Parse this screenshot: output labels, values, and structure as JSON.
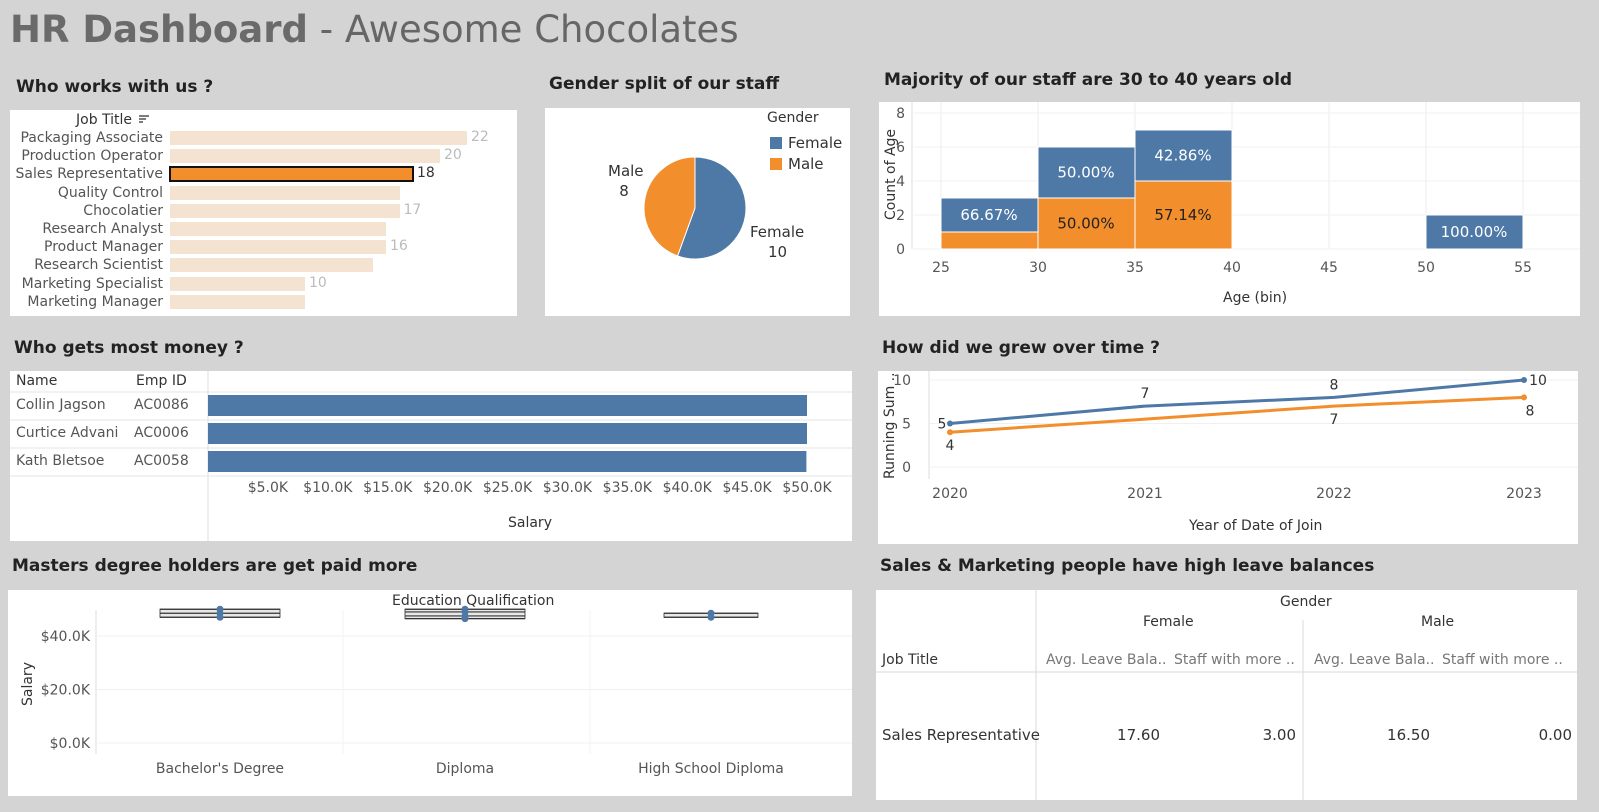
{
  "header": {
    "title_bold": "HR Dashboard",
    "title_rest": " - Awesome Chocolates"
  },
  "who_works": {
    "title": "Who works with us ?",
    "column_header": "Job Title",
    "rows": [
      {
        "label": "Packaging Associate",
        "value": 22,
        "show_value": true,
        "selected": false
      },
      {
        "label": "Production Operator",
        "value": 20,
        "show_value": true,
        "selected": false
      },
      {
        "label": "Sales Representative",
        "value": 18,
        "show_value": true,
        "selected": true
      },
      {
        "label": "Quality Control",
        "value": 17,
        "show_value": false,
        "selected": false
      },
      {
        "label": "Chocolatier",
        "value": 17,
        "show_value": true,
        "selected": false
      },
      {
        "label": "Research Analyst",
        "value": 16,
        "show_value": false,
        "selected": false
      },
      {
        "label": "Product Manager",
        "value": 16,
        "show_value": true,
        "selected": false
      },
      {
        "label": "Research Scientist",
        "value": 15,
        "show_value": false,
        "selected": false
      },
      {
        "label": "Marketing Specialist",
        "value": 10,
        "show_value": true,
        "selected": false
      },
      {
        "label": "Marketing Manager",
        "value": 10,
        "show_value": false,
        "selected": false
      }
    ],
    "colors": {
      "bar": "#f5e3d1",
      "selected": "#f28e2b"
    }
  },
  "gender_split": {
    "title": "Gender split of our staff",
    "legend_title": "Gender",
    "legend": [
      {
        "label": "Female",
        "color": "#4e79a7"
      },
      {
        "label": "Male",
        "color": "#f28e2b"
      }
    ],
    "male_label": "Male",
    "male_value": "8",
    "female_label": "Female",
    "female_value": "10",
    "chart_data": {
      "type": "pie",
      "slices": [
        {
          "label": "Female",
          "value": 10
        },
        {
          "label": "Male",
          "value": 8
        }
      ]
    }
  },
  "age_chart": {
    "title": "Majority of our staff are 30 to 40 years old",
    "ylabel": "Count of Age",
    "xlabel": "Age (bin)",
    "y_ticks": [
      "0",
      "2",
      "4",
      "6",
      "8"
    ],
    "x_ticks": [
      "25",
      "30",
      "35",
      "40",
      "45",
      "50",
      "55"
    ],
    "chart_data": {
      "type": "bar",
      "stacked": true,
      "bins": [
        25,
        30,
        35,
        50
      ],
      "ylim": [
        0,
        8
      ],
      "series": [
        {
          "name": "Male",
          "values": [
            1,
            3,
            4,
            0
          ]
        },
        {
          "name": "Female",
          "values": [
            2,
            3,
            3,
            2
          ]
        }
      ],
      "labels": [
        {
          "bin": 25,
          "series": "Female",
          "text": "66.67%"
        },
        {
          "bin": 30,
          "series": "Female",
          "text": "50.00%"
        },
        {
          "bin": 30,
          "series": "Male",
          "text": "50.00%"
        },
        {
          "bin": 35,
          "series": "Female",
          "text": "42.86%"
        },
        {
          "bin": 35,
          "series": "Male",
          "text": "57.14%"
        },
        {
          "bin": 50,
          "series": "Female",
          "text": "100.00%"
        }
      ]
    }
  },
  "money": {
    "title": "Who gets most money ?",
    "col_name": "Name",
    "col_id": "Emp ID",
    "xlabel": "Salary",
    "rows": [
      {
        "name": "Collin Jagson",
        "id": "AC0086",
        "salary": 50000
      },
      {
        "name": "Curtice Advani",
        "id": "AC0006",
        "salary": 50000
      },
      {
        "name": "Kath Bletsoe",
        "id": "AC0058",
        "salary": 49950
      }
    ],
    "x_ticks": [
      "$5.0K",
      "$10.0K",
      "$15.0K",
      "$20.0K",
      "$25.0K",
      "$30.0K",
      "$35.0K",
      "$40.0K",
      "$45.0K",
      "$50.0K"
    ]
  },
  "growth": {
    "title": "How did we grew over time ?",
    "ylabel": "Running Sum ..",
    "xlabel": "Year of Date of Join",
    "y_ticks": [
      "0",
      "5",
      "10"
    ],
    "chart_data": {
      "type": "line",
      "x": [
        "2020",
        "2021",
        "2022",
        "2023"
      ],
      "ylim": [
        0,
        10
      ],
      "series": [
        {
          "name": "Female",
          "values": [
            5,
            7,
            8,
            10
          ],
          "labels": [
            "5",
            "7",
            "8",
            "10"
          ]
        },
        {
          "name": "Male",
          "values": [
            4,
            5.5,
            7,
            8
          ],
          "labels": [
            "4",
            "",
            "7",
            "8"
          ]
        }
      ]
    }
  },
  "masters": {
    "title": "Masters degree holders are get paid more",
    "header": "Education Qualification",
    "ylabel": "Salary",
    "y_ticks": [
      "$0.0K",
      "$20.0K",
      "$40.0K"
    ],
    "chart_data": {
      "type": "scatter",
      "categories": [
        "Bachelor's Degree",
        "Diploma",
        "High School Diploma"
      ],
      "points": [
        [
          50000,
          48500,
          47000
        ],
        [
          50000,
          49000,
          47500,
          46500
        ],
        [
          48500,
          47000
        ]
      ],
      "ylim": [
        0,
        52000
      ]
    }
  },
  "leave": {
    "title": "Sales & Marketing people have high leave balances",
    "gender_header": "Gender",
    "female": "Female",
    "male": "Male",
    "row_header": "Job Title",
    "col1": "Avg. Leave Bala..",
    "col2": "Staff with more ..",
    "col3": "Avg. Leave Bala..",
    "col4": "Staff with more ..",
    "row": {
      "label": "Sales Representative",
      "v1": "17.60",
      "v2": "3.00",
      "v3": "16.50",
      "v4": "0.00"
    }
  }
}
